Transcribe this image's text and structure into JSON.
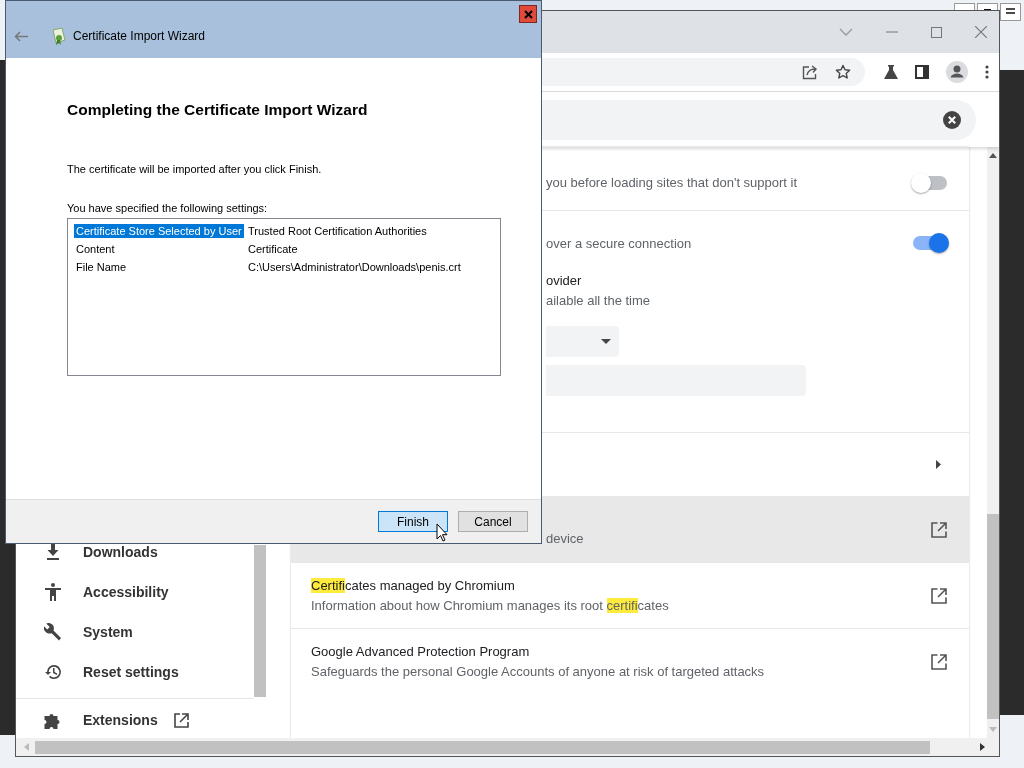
{
  "dialog": {
    "title": "Certificate Import Wizard",
    "heading": "Completing the Certificate Import Wizard",
    "intro": "The certificate will be imported after you click Finish.",
    "settings_label": "You have specified the following settings:",
    "settings": [
      {
        "name": "Certificate Store Selected by User",
        "value": "Trusted Root Certification Authorities",
        "selected": true
      },
      {
        "name": "Content",
        "value": "Certificate",
        "selected": false
      },
      {
        "name": "File Name",
        "value": "C:\\Users\\Administrator\\Downloads\\penis.crt",
        "selected": false
      }
    ],
    "buttons": [
      {
        "label": "Finish",
        "default": true
      },
      {
        "label": "Cancel",
        "default": false
      }
    ]
  },
  "browser": {
    "sidebar": {
      "items": [
        {
          "label": "Downloads"
        },
        {
          "label": "Accessibility"
        },
        {
          "label": "System"
        },
        {
          "label": "Reset settings"
        }
      ],
      "extensions": "Extensions"
    },
    "rows": [
      {
        "kind": "toggle",
        "clipped": true,
        "lines": [
          "you before loading sites that don't support it"
        ],
        "on": false
      },
      {
        "kind": "secure-dns",
        "clipped": true,
        "lines": [
          "over a secure connection"
        ],
        "on": true,
        "provider_lines": [
          "ovider",
          "ailable all the time"
        ]
      },
      {
        "kind": "submenu"
      },
      {
        "kind": "external",
        "clipped": true,
        "hovered": true,
        "title": [],
        "description": [
          {
            "text": "device",
            "match": false
          }
        ]
      },
      {
        "kind": "external",
        "clipped": false,
        "hovered": false,
        "title": [
          {
            "text": "Certifi",
            "match": true
          },
          {
            "text": "cates managed by Chromium",
            "match": false
          }
        ],
        "description": [
          {
            "text": "Information about how Chromium manages its root ",
            "match": false
          },
          {
            "text": "certifi",
            "match": true
          },
          {
            "text": "cates",
            "match": false
          }
        ]
      },
      {
        "kind": "external",
        "clipped": false,
        "hovered": false,
        "title": [
          {
            "text": "Google Advanced Protection Program",
            "match": false
          }
        ],
        "description": [
          {
            "text": "Safeguards the personal Google Accounts of anyone at risk of targeted attacks",
            "match": false
          }
        ]
      }
    ]
  }
}
